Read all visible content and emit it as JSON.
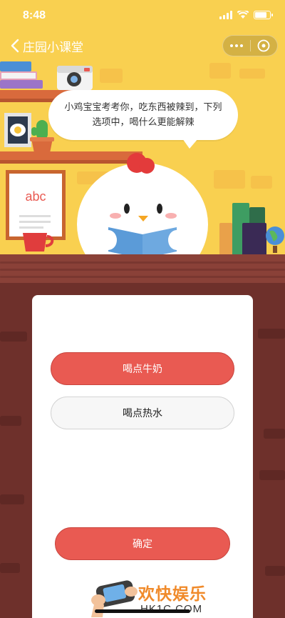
{
  "status_bar": {
    "time": "8:48"
  },
  "nav": {
    "title": "庄园小课堂",
    "back_icon": "chevron-left-icon",
    "more_icon": "more-dots-icon",
    "close_icon": "close-circle-icon"
  },
  "question": {
    "text": "小鸡宝宝考考你，吃东西被辣到，下列选项中，喝什么更能解辣"
  },
  "options": [
    {
      "label": "喝点牛奶",
      "selected": true
    },
    {
      "label": "喝点热水",
      "selected": false
    }
  ],
  "confirm_label": "确定",
  "scene": {
    "board_text": "abc"
  },
  "watermark": {
    "main": "欢快娱乐",
    "sub": "HK1C.COM"
  },
  "colors": {
    "scene_bg": "#f9d050",
    "wall": "#6e302b",
    "accent": "#e95a52",
    "watermark": "#f08a2a"
  }
}
